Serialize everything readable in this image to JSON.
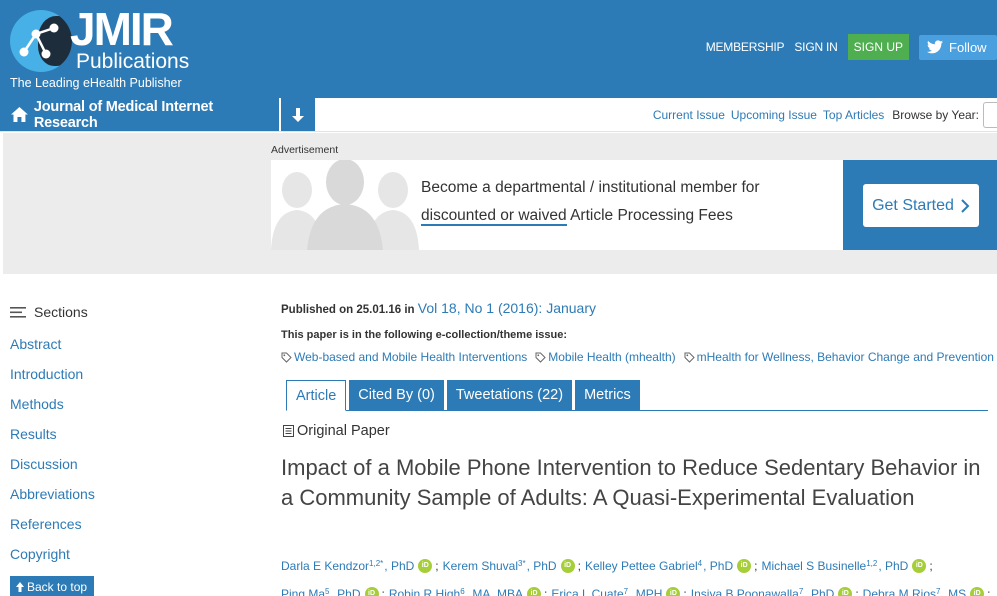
{
  "header": {
    "logo_main": "JMIR",
    "logo_sub": "Publications",
    "logo_tagline": "The Leading eHealth Publisher",
    "nav": {
      "membership": "MEMBERSHIP",
      "sign_in": "SIGN IN",
      "sign_up": "SIGN UP",
      "follow": "Follow"
    }
  },
  "journal_bar": {
    "title": "Journal of Medical Internet Research",
    "links": [
      "Current Issue",
      "Upcoming Issue",
      "Top Articles"
    ],
    "browse_label": "Browse by Year:"
  },
  "ad": {
    "label": "Advertisement",
    "line1": "Become a departmental / institutional member for",
    "line2_underlined": "discounted or waived",
    "line2_rest": " Article Processing Fees",
    "cta": "Get Started"
  },
  "sidebar": {
    "heading": "Sections",
    "items": [
      "Abstract",
      "Introduction",
      "Methods",
      "Results",
      "Discussion",
      "Abbreviations",
      "References",
      "Copyright"
    ],
    "back_to_top": "Back to top"
  },
  "article": {
    "published_label": "Published on 25.01.16 in",
    "published_link": "Vol 18, No 1 (2016): January",
    "collection_label": "This paper is in the following e-collection/theme issue:",
    "collections": [
      "Web-based and Mobile Health Interventions",
      "Mobile Health (mhealth)",
      "mHealth for Wellness, Behavior Change and Prevention"
    ],
    "tabs": [
      "Article",
      "Cited By (0)",
      "Tweetations (22)",
      "Metrics"
    ],
    "type": "Original Paper",
    "title": "Impact of a Mobile Phone Intervention to Reduce Sedentary Behavior in a Community Sample of Adults: A Quasi-Experimental Evaluation",
    "orcid_label": "iD",
    "separator": ";",
    "authors_line1": [
      {
        "name": "Darla E Kendzor",
        "sup": "1,2*",
        "degree": ", PhD"
      },
      {
        "name": "Kerem Shuval",
        "sup": "3*",
        "degree": ", PhD"
      },
      {
        "name": "Kelley Pettee Gabriel",
        "sup": "4",
        "degree": ", PhD"
      },
      {
        "name": "Michael S Businelle",
        "sup": "1,2",
        "degree": ", PhD"
      }
    ],
    "authors_line2": [
      {
        "name": "Ping Ma",
        "sup": "5",
        "degree": ", PhD"
      },
      {
        "name": "Robin R High",
        "sup": "6",
        "degree": ", MA, MBA"
      },
      {
        "name": "Erica L Cuate",
        "sup": "7",
        "degree": ", MPH"
      },
      {
        "name": "Insiya B Poonawalla",
        "sup": "7",
        "degree": ", PhD"
      },
      {
        "name": "Debra M Rios",
        "sup": "7",
        "degree": ", MS"
      }
    ]
  }
}
